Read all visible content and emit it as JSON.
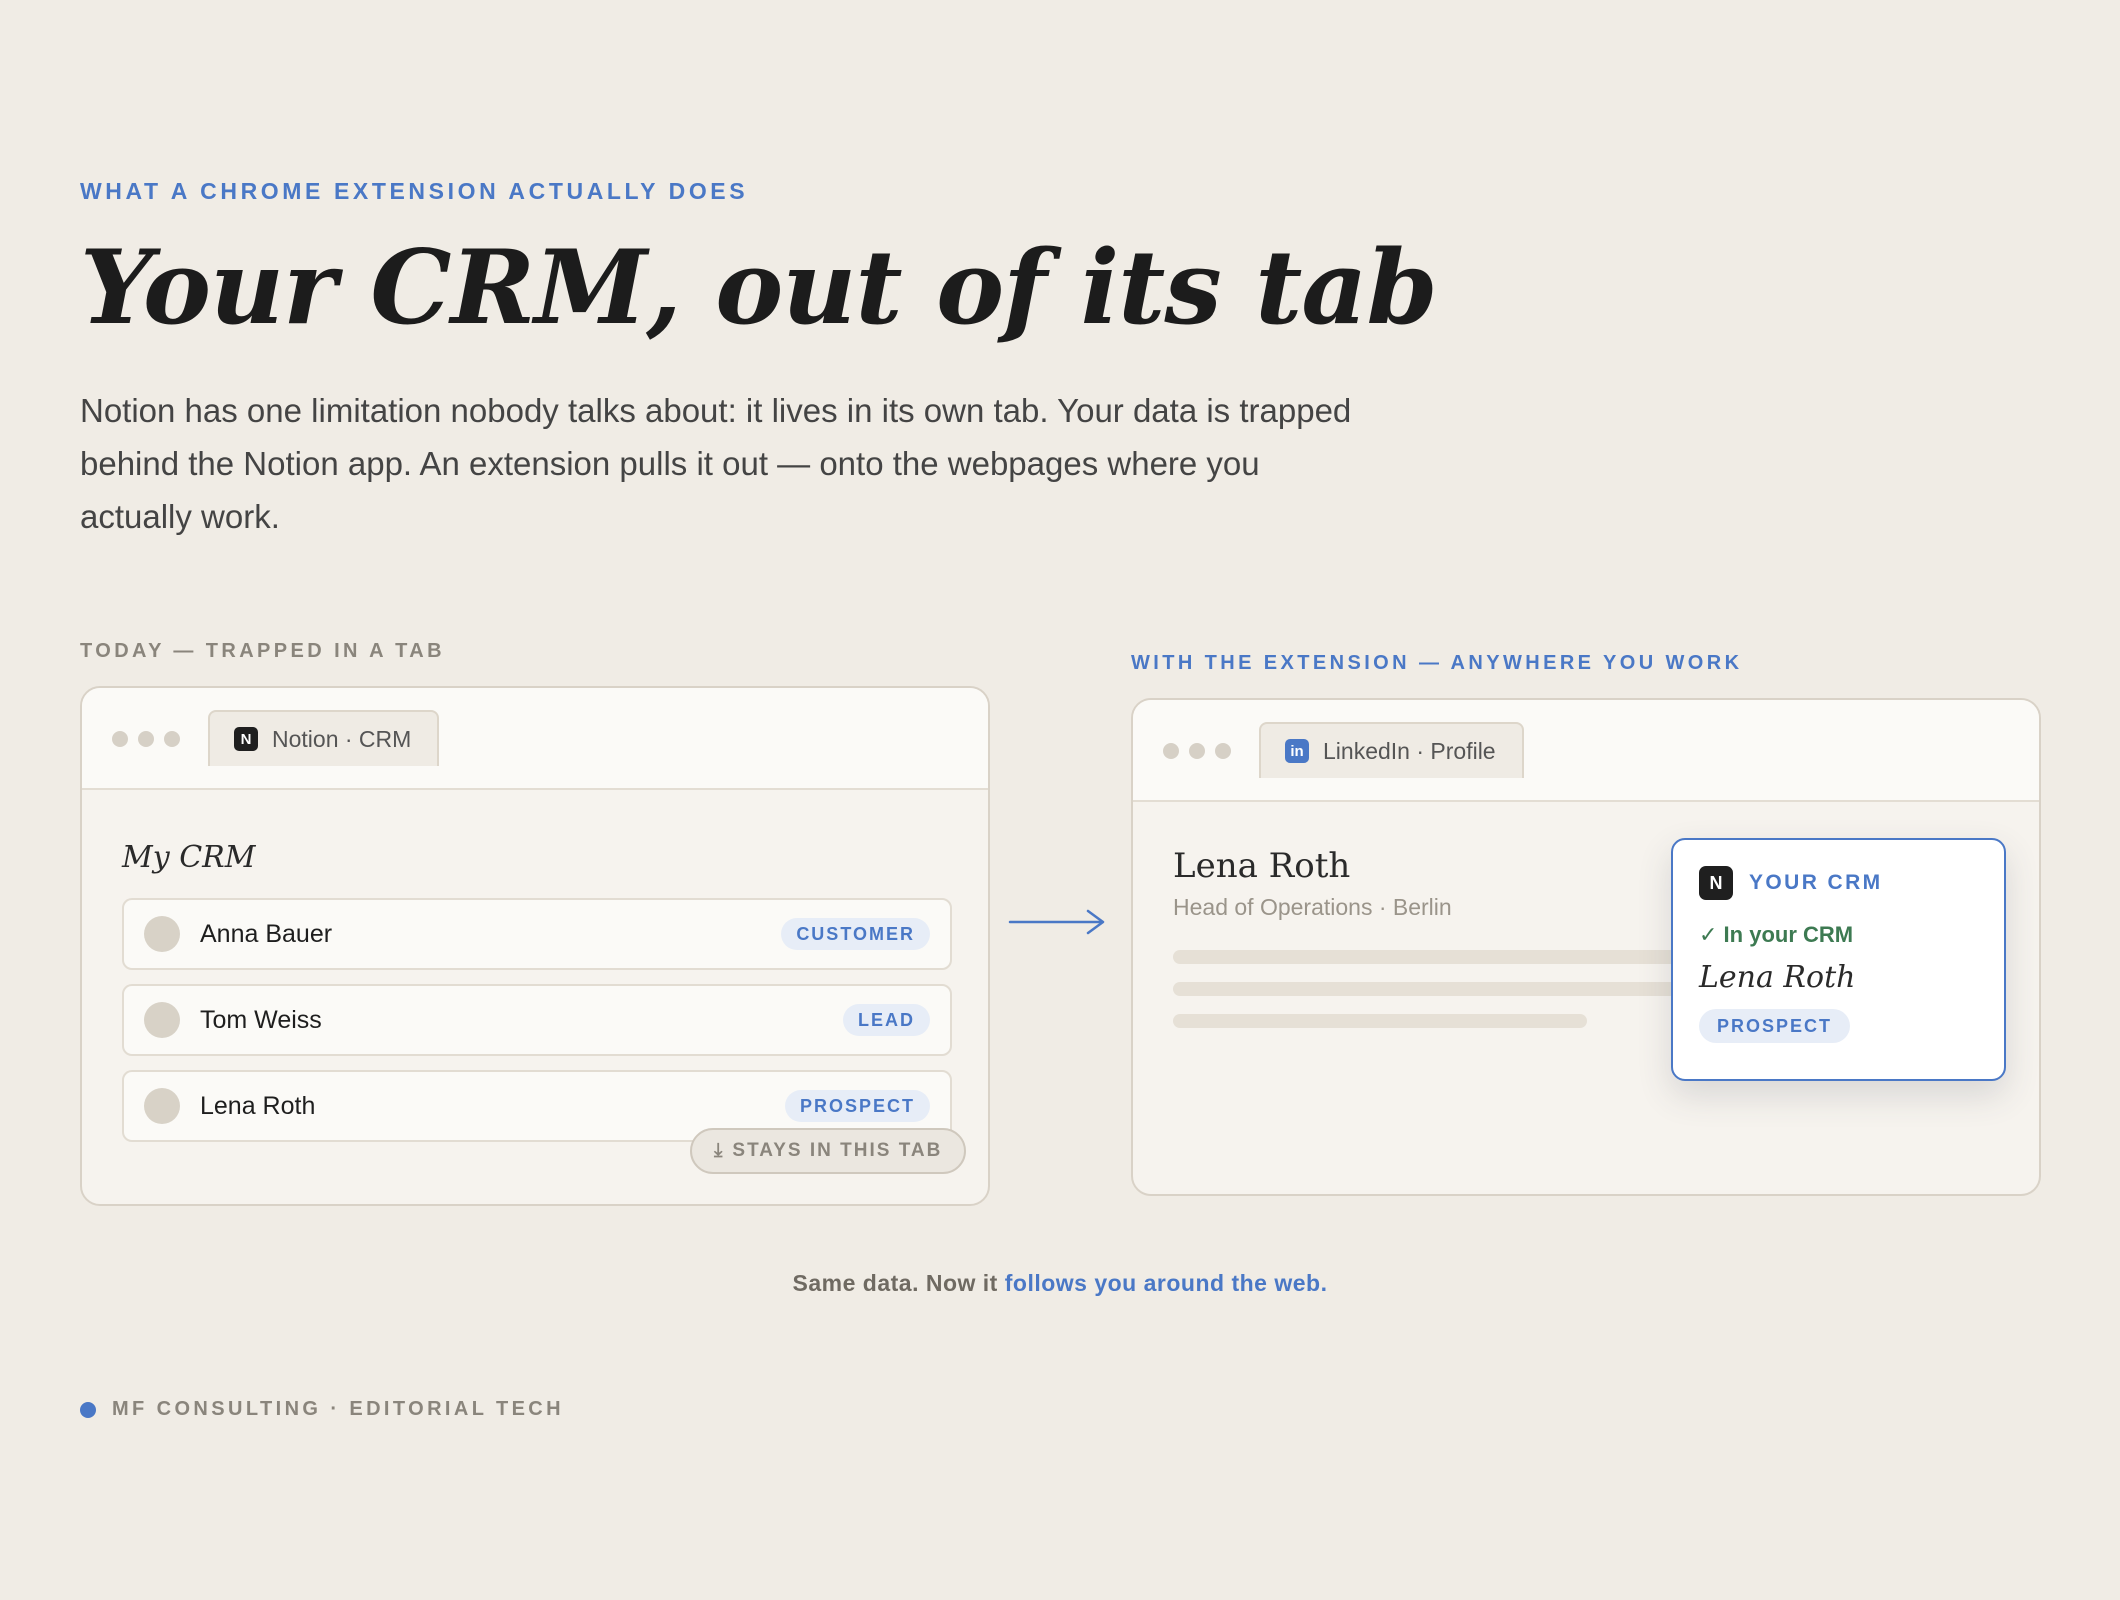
{
  "eyebrow": "WHAT A CHROME EXTENSION ACTUALLY DOES",
  "headline": "Your CRM, out of its tab",
  "lede": "Notion has one limitation nobody talks about: it lives in its own tab. Your data is trapped behind the Notion app. An extension pulls it out — onto the webpages where you actually work.",
  "today": {
    "label": "TODAY — TRAPPED IN A TAB",
    "tab_icon": "N",
    "tab_label": "Notion · CRM",
    "crm_title": "My CRM",
    "rows": [
      {
        "name": "Anna Bauer",
        "tag": "CUSTOMER"
      },
      {
        "name": "Tom Weiss",
        "tag": "LEAD"
      },
      {
        "name": "Lena Roth",
        "tag": "PROSPECT"
      }
    ],
    "stays_icon": "⤓",
    "stays_label": "STAYS IN THIS TAB"
  },
  "extension": {
    "label": "WITH THE EXTENSION — ANYWHERE YOU WORK",
    "tab_icon": "in",
    "tab_label": "LinkedIn · Profile",
    "profile_name": "Lena Roth",
    "profile_sub": "Head of Operations · Berlin",
    "popover": {
      "icon": "N",
      "title": "YOUR CRM",
      "status": "✓ In your CRM",
      "name": "Lena Roth",
      "tag": "PROSPECT"
    }
  },
  "caption": {
    "lead": "Same data. Now it ",
    "accent": "follows you around the web."
  },
  "footer": "MF CONSULTING · EDITORIAL TECH",
  "colors": {
    "background": "#f0ece5",
    "accent": "#4a78c6",
    "success": "#3d7a52"
  }
}
